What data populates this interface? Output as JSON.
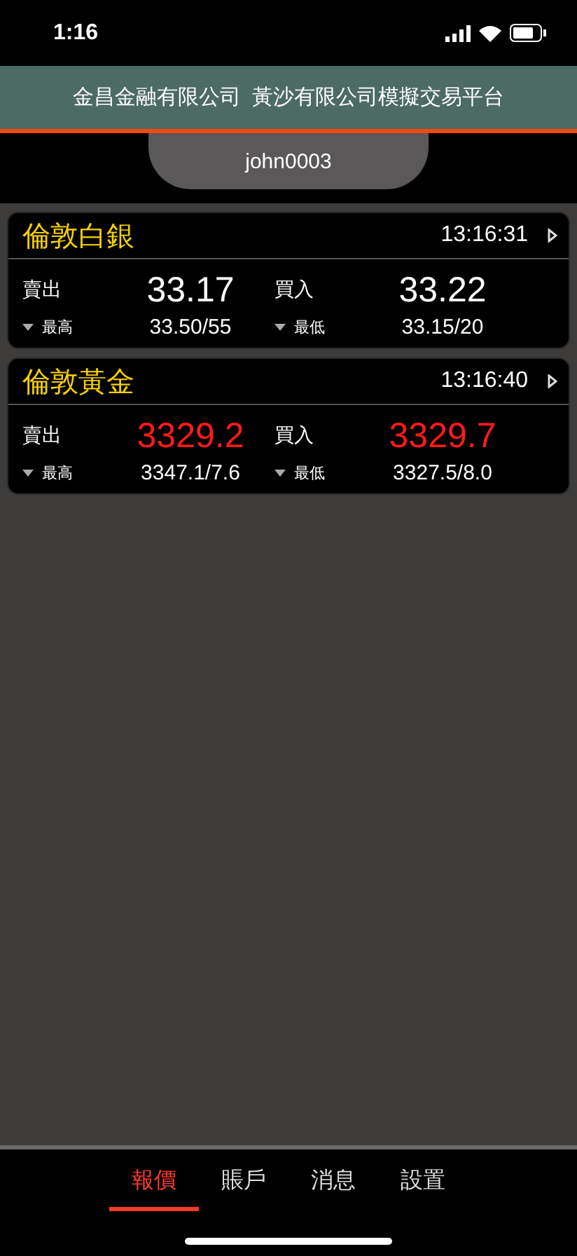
{
  "status_bar": {
    "time": "1:16"
  },
  "header": {
    "title": "金昌金融有限公司  黃沙有限公司模擬交易平台"
  },
  "user": {
    "name": "john0003"
  },
  "quotes": [
    {
      "name": "倫敦白銀",
      "time": "13:16:31",
      "color": "#ffffff",
      "sell_label": "賣出",
      "sell": "33.17",
      "buy_label": "買入",
      "buy": "33.22",
      "high_label": "最高",
      "high": "33.50/55",
      "low_label": "最低",
      "low": "33.15/20"
    },
    {
      "name": "倫敦黃金",
      "time": "13:16:40",
      "color": "#ff1a1a",
      "sell_label": "賣出",
      "sell": "3329.2",
      "buy_label": "買入",
      "buy": "3329.7",
      "high_label": "最高",
      "high": "3347.1/7.6",
      "low_label": "最低",
      "low": "3327.5/8.0"
    }
  ],
  "tabs": [
    {
      "label": "報價",
      "selected": true
    },
    {
      "label": "賬戶",
      "selected": false
    },
    {
      "label": "消息",
      "selected": false
    },
    {
      "label": "設置",
      "selected": false
    }
  ]
}
